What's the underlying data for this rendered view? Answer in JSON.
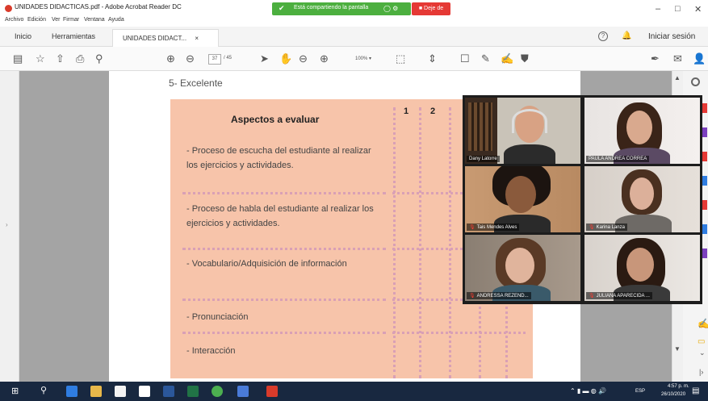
{
  "window": {
    "title": "UNIDADES DIDACTICAS.pdf - Adobe Acrobat Reader DC",
    "share_status": "Está compartiendo la pantalla",
    "stop_share_label": "Deje de",
    "minimize": "–",
    "maximize": "□",
    "close": "✕"
  },
  "menu": [
    "Archivo",
    "Edición",
    "Ver",
    "Firmar",
    "Ventana",
    "Ayuda"
  ],
  "tabs": {
    "home": "Inicio",
    "tools": "Herramientas",
    "document": "UNIDADES DIDACT...",
    "document_close": "×",
    "signin": "Iniciar sesión"
  },
  "toolbar": {
    "page_current": "37",
    "page_total": "/ 45",
    "zoom": "100%"
  },
  "document": {
    "scale_label": "5- Excelente",
    "table_header": "Aspectos a evaluar",
    "columns": [
      "1",
      "2"
    ],
    "criteria": [
      "- Proceso de escucha del estudiante al realizar los ejercicios y actividades.",
      "- Proceso de habla del estudiante al realizar los ejercicios y actividades.",
      "- Vocabulario/Adquisición de información",
      "- Pronunciación",
      "- Interacción"
    ]
  },
  "participants": [
    {
      "name": "Dany Latorre",
      "muted": false,
      "active": true
    },
    {
      "name": "PAULA ANDREA CORREA",
      "muted": false,
      "active": false
    },
    {
      "name": "Tais Mendes Alves",
      "muted": true,
      "active": false
    },
    {
      "name": "Karina Lanza",
      "muted": true,
      "active": false
    },
    {
      "name": "ANDRESSA REZEND...",
      "muted": true,
      "active": false
    },
    {
      "name": "JULIANA APARECIDA ...",
      "muted": true,
      "active": false
    }
  ],
  "taskbar": {
    "time": "4:57 p. m.",
    "date": "26/10/2020",
    "lang": "ESP"
  },
  "colors": {
    "table_bg": "#f7c4aa",
    "dots": "#d9a0b5",
    "share_green": "#4caf3f",
    "stop_red": "#e53935",
    "taskbar": "#182840",
    "viewer_gray": "#a4a4a4"
  }
}
